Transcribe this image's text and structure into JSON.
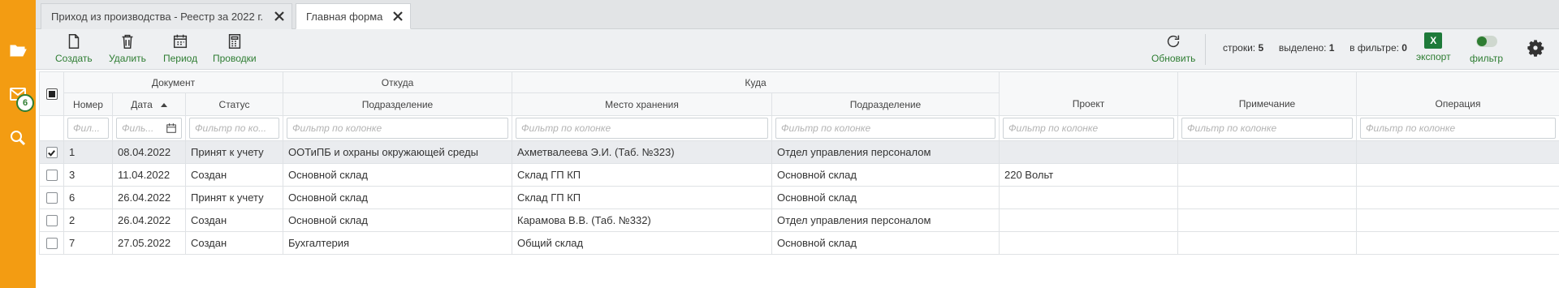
{
  "sidebar": {
    "mail_badge": "6"
  },
  "tabs": [
    {
      "label": "Приход из производства - Реестр за 2022 г."
    },
    {
      "label": "Главная форма"
    }
  ],
  "toolbar": {
    "create": "Создать",
    "delete": "Удалить",
    "period": "Период",
    "postings": "Проводки",
    "refresh": "Обновить",
    "rows_label": "строки:",
    "rows_value": "5",
    "selected_label": "выделено:",
    "selected_value": "1",
    "in_filter_label": "в фильтре:",
    "in_filter_value": "0",
    "export": "экспорт",
    "excel_glyph": "X",
    "filter": "фильтр"
  },
  "grid": {
    "group_headers": {
      "document": "Документ",
      "from": "Откуда",
      "to": "Куда"
    },
    "columns": {
      "number": "Номер",
      "date": "Дата",
      "status": "Статус",
      "from_division": "Подразделение",
      "storage": "Место хранения",
      "to_division": "Подразделение",
      "project": "Проект",
      "note": "Примечание",
      "operation": "Операция"
    },
    "filters": {
      "number": "Фил...",
      "date": "Филь...",
      "status": "Фильтр по ко...",
      "generic": "Фильтр по колонке"
    },
    "rows": [
      {
        "checked": true,
        "number": "1",
        "date": "08.04.2022",
        "status": "Принят к учету",
        "from_division": "ООТиПБ и охраны окружающей среды",
        "storage": "Ахметвалеева Э.И. (Таб. №323)",
        "to_division": "Отдел управления персоналом",
        "project": "",
        "note": "",
        "operation": ""
      },
      {
        "checked": false,
        "number": "3",
        "date": "11.04.2022",
        "status": "Создан",
        "from_division": "Основной склад",
        "storage": "Склад ГП КП",
        "to_division": "Основной склад",
        "project": "220 Вольт",
        "note": "",
        "operation": ""
      },
      {
        "checked": false,
        "number": "6",
        "date": "26.04.2022",
        "status": "Принят к учету",
        "from_division": "Основной склад",
        "storage": "Склад ГП КП",
        "to_division": "Основной склад",
        "project": "",
        "note": "",
        "operation": ""
      },
      {
        "checked": false,
        "number": "2",
        "date": "26.04.2022",
        "status": "Создан",
        "from_division": "Основной склад",
        "storage": "Карамова В.В. (Таб. №332)",
        "to_division": "Отдел управления персоналом",
        "project": "",
        "note": "",
        "operation": ""
      },
      {
        "checked": false,
        "number": "7",
        "date": "27.05.2022",
        "status": "Создан",
        "from_division": "Бухгалтерия",
        "storage": "Общий склад",
        "to_division": "Основной склад",
        "project": "",
        "note": "",
        "operation": ""
      }
    ]
  }
}
